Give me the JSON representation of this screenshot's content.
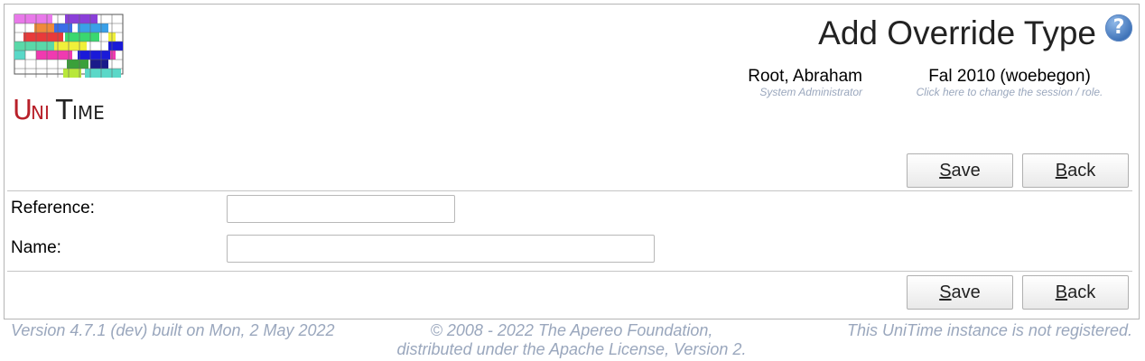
{
  "header": {
    "logo_text": "UniTime",
    "title": "Add Override Type",
    "help_icon": "help-circle-icon",
    "user_name": "Root, Abraham",
    "user_role": "System Administrator",
    "session_name": "Fal 2010 (woebegon)",
    "session_hint": "Click here to change the session / role."
  },
  "buttons": {
    "save_prefix": "S",
    "save_rest": "ave",
    "back_prefix": "B",
    "back_rest": "ack"
  },
  "form": {
    "reference_label": "Reference:",
    "reference_value": "",
    "name_label": "Name:",
    "name_value": ""
  },
  "footer": {
    "version": "Version 4.7.1 (dev) built on Mon, 2 May 2022",
    "copyright_line1": "© 2008 - 2022 The Apereo Foundation,",
    "copyright_line2": "distributed under the Apache License, Version 2.",
    "registration": "This UniTime instance is not registered."
  },
  "colors": {
    "accent_text": "#9aa7bd",
    "border": "#b5b5b5"
  }
}
